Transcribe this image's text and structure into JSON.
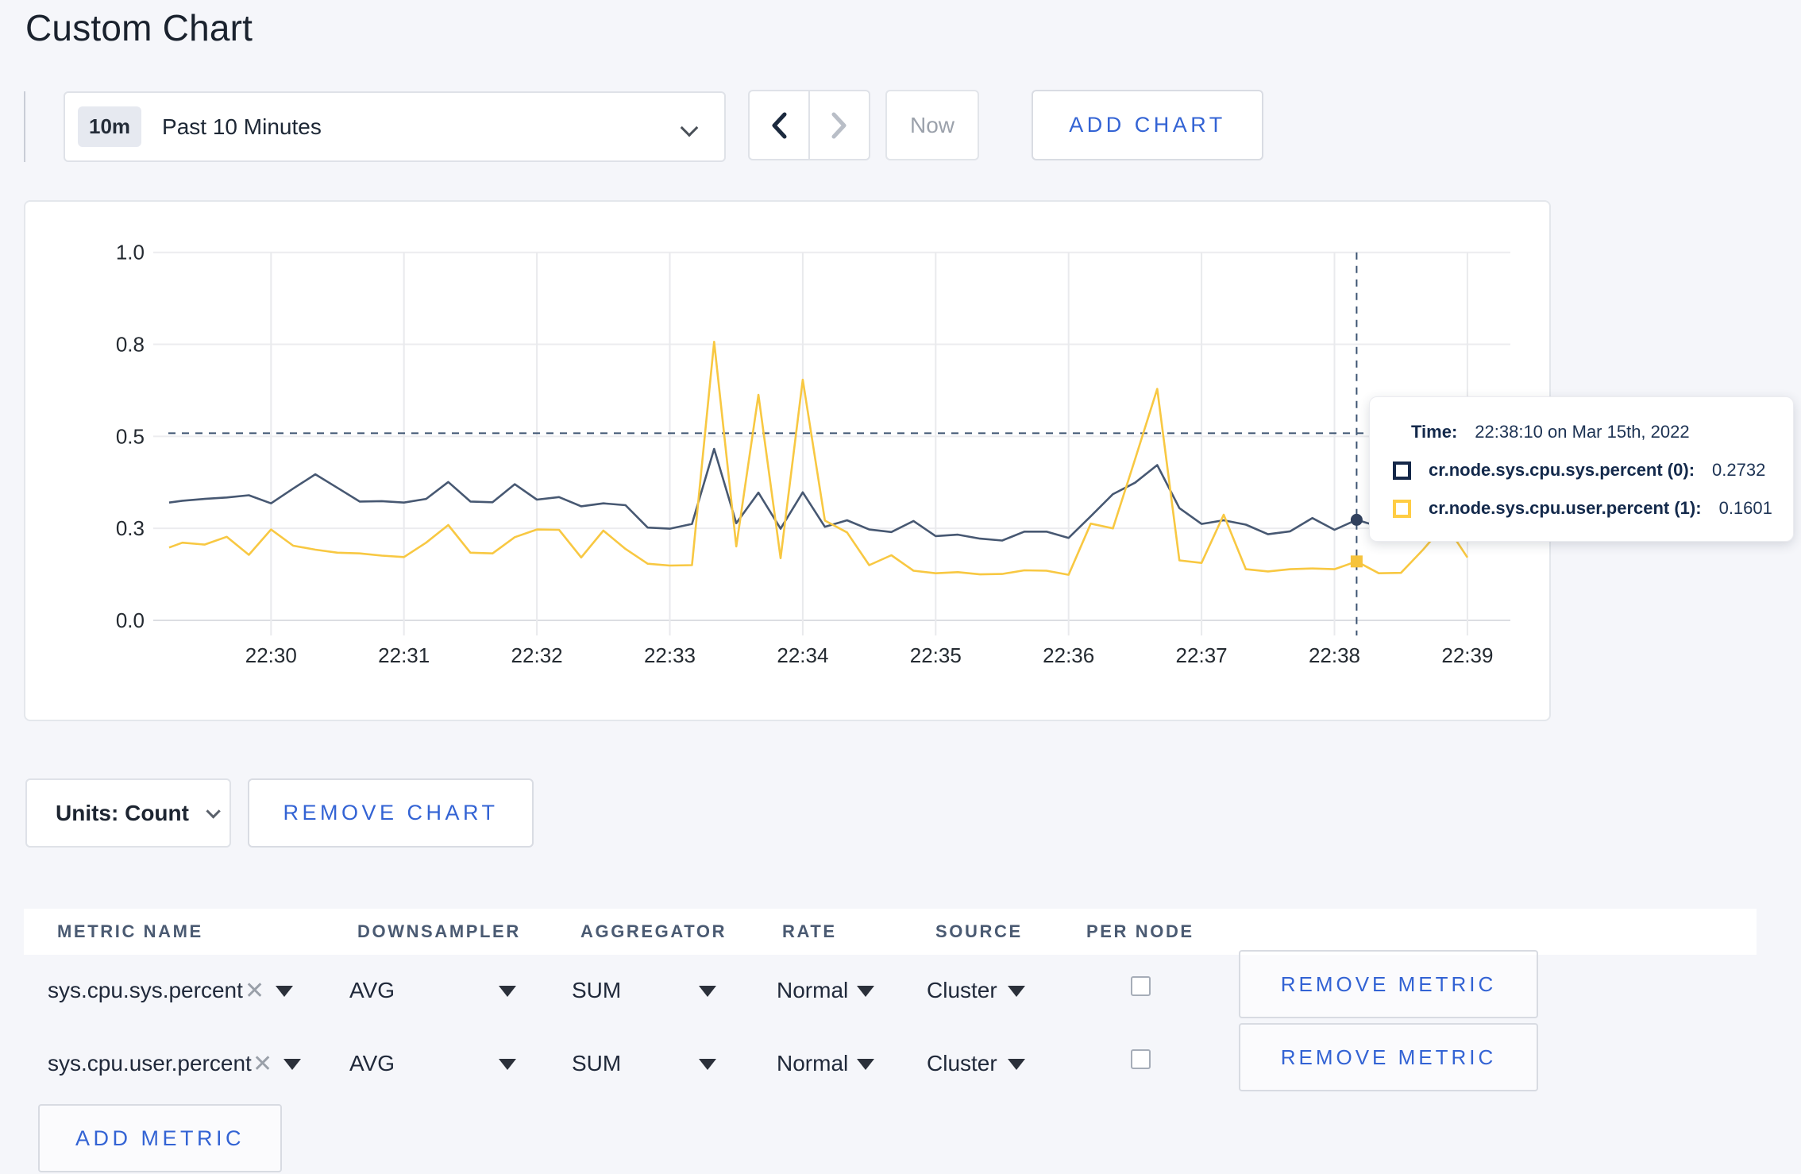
{
  "page": {
    "title": "Custom Chart"
  },
  "colors": {
    "accent_blue": "#3363d4",
    "series_sys": "#475872",
    "series_user": "#F8C842",
    "tooltip_navy": "#152849",
    "tooltip_yellow": "#FFCD44",
    "grid": "#ececef",
    "axis_text": "#242a31"
  },
  "toolbar": {
    "range_badge": "10m",
    "range_label": "Past 10 Minutes",
    "prev_icon": "chevron-left",
    "next_icon": "chevron-right",
    "now_label": "Now",
    "add_chart_label": "ADD CHART"
  },
  "chart_data": {
    "type": "line",
    "title": "",
    "xlabel": "",
    "ylabel": "",
    "ylim": [
      0,
      1
    ],
    "grid": true,
    "x_domain": [
      "22:29:14",
      "22:39:14"
    ],
    "x_tick_labels": [
      "22:30",
      "22:31",
      "22:32",
      "22:33",
      "22:34",
      "22:35",
      "22:36",
      "22:37",
      "22:38",
      "22:39"
    ],
    "y_ticks": [
      {
        "v": 0,
        "label": "0.0"
      },
      {
        "v": 0.25,
        "label": "0.3"
      },
      {
        "v": 0.5,
        "label": "0.5"
      },
      {
        "v": 0.75,
        "label": "0.8"
      },
      {
        "v": 1,
        "label": "1.0"
      }
    ],
    "crosshair": {
      "time": "22:38:10",
      "y_value": 0.5085
    },
    "hover_points": [
      {
        "series": 0,
        "time": "22:38:10",
        "value": 0.2732,
        "marker": "circle"
      },
      {
        "series": 1,
        "time": "22:38:10",
        "value": 0.1601,
        "marker": "square"
      }
    ],
    "series": [
      {
        "name": "cr.node.sys.cpu.sys.percent (0)",
        "color": "#475872",
        "points": [
          [
            "22:29:14",
            0.32
          ],
          [
            "22:29:20",
            0.325
          ],
          [
            "22:29:30",
            0.33
          ],
          [
            "22:29:40",
            0.334
          ],
          [
            "22:29:50",
            0.34
          ],
          [
            "22:30:00",
            0.318
          ],
          [
            "22:30:10",
            0.358
          ],
          [
            "22:30:20",
            0.397
          ],
          [
            "22:30:30",
            0.36
          ],
          [
            "22:30:40",
            0.323
          ],
          [
            "22:30:50",
            0.324
          ],
          [
            "22:31:00",
            0.32
          ],
          [
            "22:31:10",
            0.33
          ],
          [
            "22:31:20",
            0.376
          ],
          [
            "22:31:30",
            0.323
          ],
          [
            "22:31:40",
            0.321
          ],
          [
            "22:31:50",
            0.37
          ],
          [
            "22:32:00",
            0.328
          ],
          [
            "22:32:10",
            0.335
          ],
          [
            "22:32:20",
            0.31
          ],
          [
            "22:32:30",
            0.318
          ],
          [
            "22:32:40",
            0.313
          ],
          [
            "22:32:50",
            0.252
          ],
          [
            "22:33:00",
            0.249
          ],
          [
            "22:33:10",
            0.262
          ],
          [
            "22:33:20",
            0.466
          ],
          [
            "22:33:30",
            0.264
          ],
          [
            "22:33:40",
            0.347
          ],
          [
            "22:33:50",
            0.249
          ],
          [
            "22:34:00",
            0.348
          ],
          [
            "22:34:10",
            0.254
          ],
          [
            "22:34:20",
            0.272
          ],
          [
            "22:34:30",
            0.247
          ],
          [
            "22:34:40",
            0.24
          ],
          [
            "22:34:50",
            0.27
          ],
          [
            "22:35:00",
            0.229
          ],
          [
            "22:35:10",
            0.233
          ],
          [
            "22:35:20",
            0.222
          ],
          [
            "22:35:30",
            0.217
          ],
          [
            "22:35:40",
            0.241
          ],
          [
            "22:35:50",
            0.241
          ],
          [
            "22:36:00",
            0.224
          ],
          [
            "22:36:10",
            0.283
          ],
          [
            "22:36:20",
            0.343
          ],
          [
            "22:36:30",
            0.374
          ],
          [
            "22:36:40",
            0.422
          ],
          [
            "22:36:50",
            0.305
          ],
          [
            "22:37:00",
            0.262
          ],
          [
            "22:37:10",
            0.272
          ],
          [
            "22:37:20",
            0.26
          ],
          [
            "22:37:30",
            0.234
          ],
          [
            "22:37:40",
            0.242
          ],
          [
            "22:37:50",
            0.278
          ],
          [
            "22:38:00",
            0.246
          ],
          [
            "22:38:10",
            0.2732
          ],
          [
            "22:38:20",
            0.255
          ],
          [
            "22:38:30",
            0.252
          ],
          [
            "22:38:40",
            0.26
          ],
          [
            "22:38:50",
            0.295
          ],
          [
            "22:39:00",
            0.3
          ]
        ]
      },
      {
        "name": "cr.node.sys.cpu.user.percent (1)",
        "color": "#F8C842",
        "points": [
          [
            "22:29:14",
            0.198
          ],
          [
            "22:29:20",
            0.211
          ],
          [
            "22:29:30",
            0.206
          ],
          [
            "22:29:40",
            0.227
          ],
          [
            "22:29:50",
            0.178
          ],
          [
            "22:30:00",
            0.247
          ],
          [
            "22:30:10",
            0.203
          ],
          [
            "22:30:20",
            0.192
          ],
          [
            "22:30:30",
            0.184
          ],
          [
            "22:30:40",
            0.182
          ],
          [
            "22:30:50",
            0.176
          ],
          [
            "22:31:00",
            0.172
          ],
          [
            "22:31:10",
            0.211
          ],
          [
            "22:31:20",
            0.259
          ],
          [
            "22:31:30",
            0.184
          ],
          [
            "22:31:40",
            0.182
          ],
          [
            "22:31:50",
            0.226
          ],
          [
            "22:32:00",
            0.247
          ],
          [
            "22:32:10",
            0.246
          ],
          [
            "22:32:20",
            0.171
          ],
          [
            "22:32:30",
            0.244
          ],
          [
            "22:32:40",
            0.194
          ],
          [
            "22:32:50",
            0.154
          ],
          [
            "22:33:00",
            0.149
          ],
          [
            "22:33:10",
            0.15
          ],
          [
            "22:33:20",
            0.757
          ],
          [
            "22:33:30",
            0.201
          ],
          [
            "22:33:40",
            0.613
          ],
          [
            "22:33:50",
            0.169
          ],
          [
            "22:34:00",
            0.654
          ],
          [
            "22:34:10",
            0.271
          ],
          [
            "22:34:20",
            0.239
          ],
          [
            "22:34:30",
            0.15
          ],
          [
            "22:34:40",
            0.177
          ],
          [
            "22:34:50",
            0.135
          ],
          [
            "22:35:00",
            0.128
          ],
          [
            "22:35:10",
            0.131
          ],
          [
            "22:35:20",
            0.125
          ],
          [
            "22:35:30",
            0.126
          ],
          [
            "22:35:40",
            0.136
          ],
          [
            "22:35:50",
            0.135
          ],
          [
            "22:36:00",
            0.124
          ],
          [
            "22:36:10",
            0.263
          ],
          [
            "22:36:20",
            0.25
          ],
          [
            "22:36:30",
            0.438
          ],
          [
            "22:36:40",
            0.629
          ],
          [
            "22:36:50",
            0.163
          ],
          [
            "22:37:00",
            0.156
          ],
          [
            "22:37:10",
            0.287
          ],
          [
            "22:37:20",
            0.139
          ],
          [
            "22:37:30",
            0.133
          ],
          [
            "22:37:40",
            0.139
          ],
          [
            "22:37:50",
            0.141
          ],
          [
            "22:38:00",
            0.139
          ],
          [
            "22:38:10",
            0.1601
          ],
          [
            "22:38:20",
            0.128
          ],
          [
            "22:38:30",
            0.129
          ],
          [
            "22:38:40",
            0.192
          ],
          [
            "22:38:50",
            0.262
          ],
          [
            "22:39:00",
            0.171
          ]
        ]
      }
    ]
  },
  "tooltip": {
    "time_label": "Time:",
    "time_value": "22:38:10 on Mar 15th, 2022",
    "rows": [
      {
        "name": "cr.node.sys.cpu.sys.percent (0):",
        "value": "0.2732"
      },
      {
        "name": "cr.node.sys.cpu.user.percent (1):",
        "value": "0.1601"
      }
    ]
  },
  "controls": {
    "units_label": "Units: Count",
    "remove_chart_label": "REMOVE CHART",
    "add_metric_label": "ADD METRIC"
  },
  "table": {
    "headers": [
      "METRIC NAME",
      "DOWNSAMPLER",
      "AGGREGATOR",
      "RATE",
      "SOURCE",
      "PER NODE"
    ],
    "remove_metric_label": "REMOVE METRIC",
    "rows": [
      {
        "metric": "sys.cpu.sys.percent",
        "downsampler": "AVG",
        "aggregator": "SUM",
        "rate": "Normal",
        "source": "Cluster",
        "per_node_checked": false
      },
      {
        "metric": "sys.cpu.user.percent",
        "downsampler": "AVG",
        "aggregator": "SUM",
        "rate": "Normal",
        "source": "Cluster",
        "per_node_checked": false
      }
    ]
  }
}
